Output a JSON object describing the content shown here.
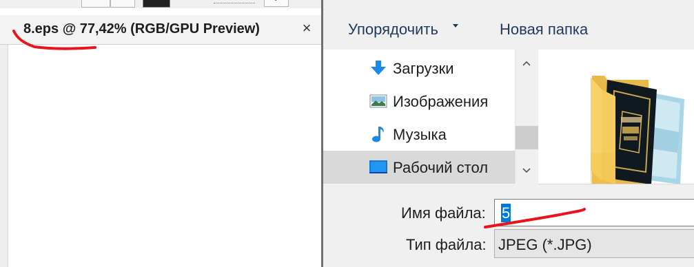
{
  "document_tab": {
    "title": "8.eps @ 77,42% (RGB/GPU Preview)",
    "close_glyph": "×"
  },
  "toolbar": {
    "dropdown_glyph": "⌄"
  },
  "save_dialog": {
    "command_bar": {
      "organize_label": "Упорядочить",
      "new_folder_label": "Новая папка"
    },
    "nav_items": [
      {
        "label": "Загрузки",
        "icon": "downloads-arrow-icon"
      },
      {
        "label": "Изображения",
        "icon": "pictures-icon"
      },
      {
        "label": "Музыка",
        "icon": "music-note-icon"
      },
      {
        "label": "Рабочий стол",
        "icon": "desktop-icon",
        "selected": true
      }
    ],
    "file_name_label": "Имя файла:",
    "file_name_value": "5",
    "file_type_label": "Тип файла:",
    "file_type_value": "JPEG (*.JPG)",
    "preview_folder_icon": "folder-with-images-icon"
  },
  "colors": {
    "annotation_red": "#e8141b",
    "selection_blue": "#0078d7",
    "command_text": "#1e395b"
  }
}
